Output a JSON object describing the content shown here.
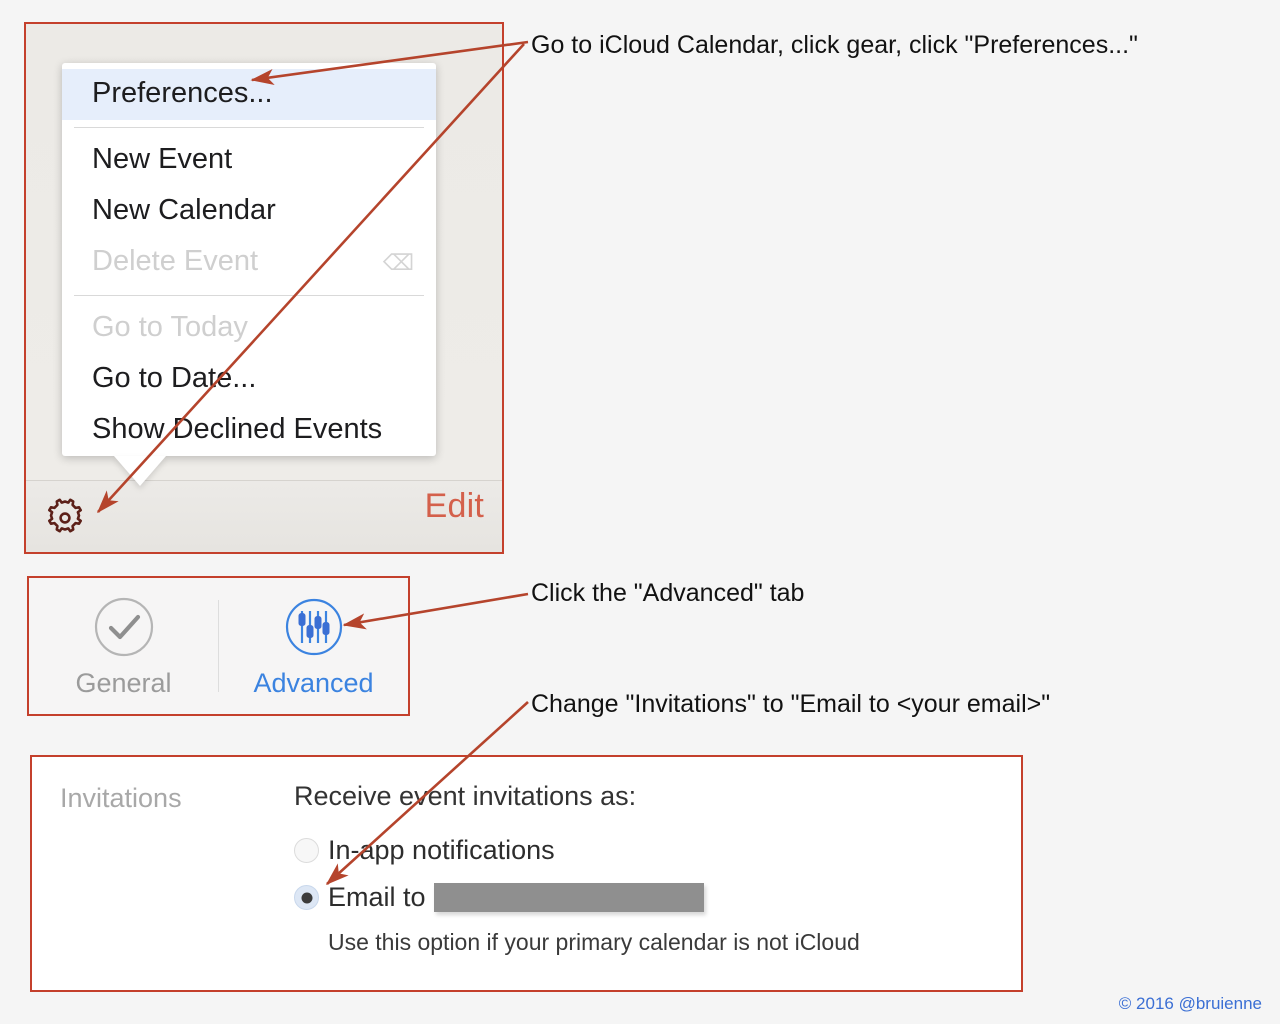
{
  "page": {
    "background_color": "#f5f5f5",
    "annotation_color": "#c4402c"
  },
  "credit": {
    "text": "© 2016 @bruienne",
    "color": "#3b6fd4"
  },
  "annotations": [
    {
      "id": "step-1",
      "text": "Go to iCloud Calendar, click gear, click \"Preferences...\""
    },
    {
      "id": "step-2",
      "text": "Click the \"Advanced\" tab"
    },
    {
      "id": "step-3",
      "text": "Change \"Invitations\" to \"Email to <your email>\""
    }
  ],
  "calendar": {
    "gear_icon": "gear-icon",
    "edit_label": "Edit",
    "edit_color": "#d4604b",
    "menu": {
      "items": [
        {
          "label": "Preferences...",
          "state": "selected",
          "shortcut": ""
        },
        {
          "label": "New Event",
          "state": "normal",
          "shortcut": ""
        },
        {
          "label": "New Calendar",
          "state": "normal",
          "shortcut": ""
        },
        {
          "label": "Delete Event",
          "state": "disabled",
          "shortcut": "⌫"
        },
        {
          "label": "Go to Today",
          "state": "disabled",
          "shortcut": ""
        },
        {
          "label": "Go to Date...",
          "state": "normal",
          "shortcut": ""
        },
        {
          "label": "Show Declined Events",
          "state": "normal",
          "shortcut": ""
        }
      ]
    }
  },
  "preferences": {
    "tabs": [
      {
        "label": "General",
        "icon": "check-circle-icon",
        "selected": false,
        "color": "#9b9b9b"
      },
      {
        "label": "Advanced",
        "icon": "sliders-circle-icon",
        "selected": true,
        "color": "#3b83e0"
      }
    ]
  },
  "invitations": {
    "section_label": "Invitations",
    "heading": "Receive event invitations as:",
    "options": [
      {
        "label": "In-app notifications",
        "selected": false,
        "redacted": false
      },
      {
        "label": "Email to",
        "selected": true,
        "redacted": true
      }
    ],
    "hint": "Use this option if your primary calendar is not iCloud"
  }
}
